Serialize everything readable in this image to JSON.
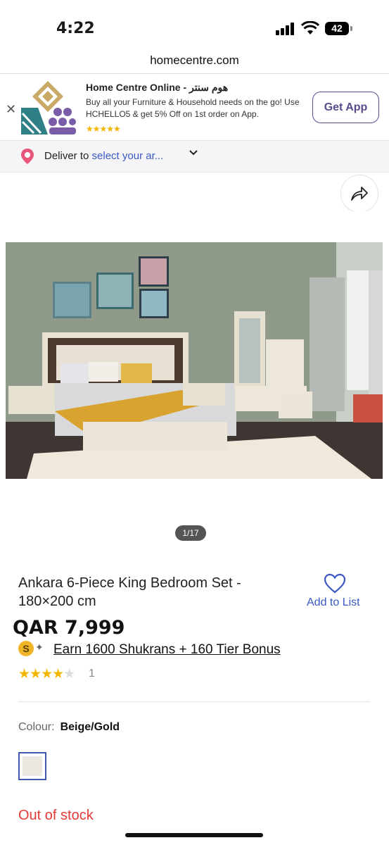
{
  "status_bar": {
    "time": "4:22",
    "battery": "42"
  },
  "browser": {
    "url": "homecentre.com"
  },
  "app_banner": {
    "title": "Home Centre Online - هوم سنتر",
    "description": "Buy all your Furniture & Household needs on the go! Use HCHELLO5 & get 5% Off on 1st order on App.",
    "stars": "★★★★★",
    "get_app_label": "Get App"
  },
  "delivery": {
    "prefix": "Deliver to",
    "link": "select your ar..."
  },
  "gallery": {
    "counter": "1/17"
  },
  "product": {
    "title": "Ankara 6-Piece King Bedroom Set - 180×200 cm",
    "wishlist_label": "Add to List",
    "price": "QAR 7,999",
    "shukran_coin": "S",
    "shukran_text": "Earn 1600 Shukrans + 160 Tier Bonus",
    "rating_on": "★★★★",
    "rating_off": "★",
    "rating_value": 4,
    "rating_count": "1",
    "colour_label": "Colour:",
    "colour_value": "Beige/Gold",
    "stock_status": "Out of stock"
  },
  "colors": {
    "accent": "#3a57c4",
    "brand_purple": "#5a4a8c",
    "out_of_stock": "#e53935",
    "star": "#f5b400"
  }
}
